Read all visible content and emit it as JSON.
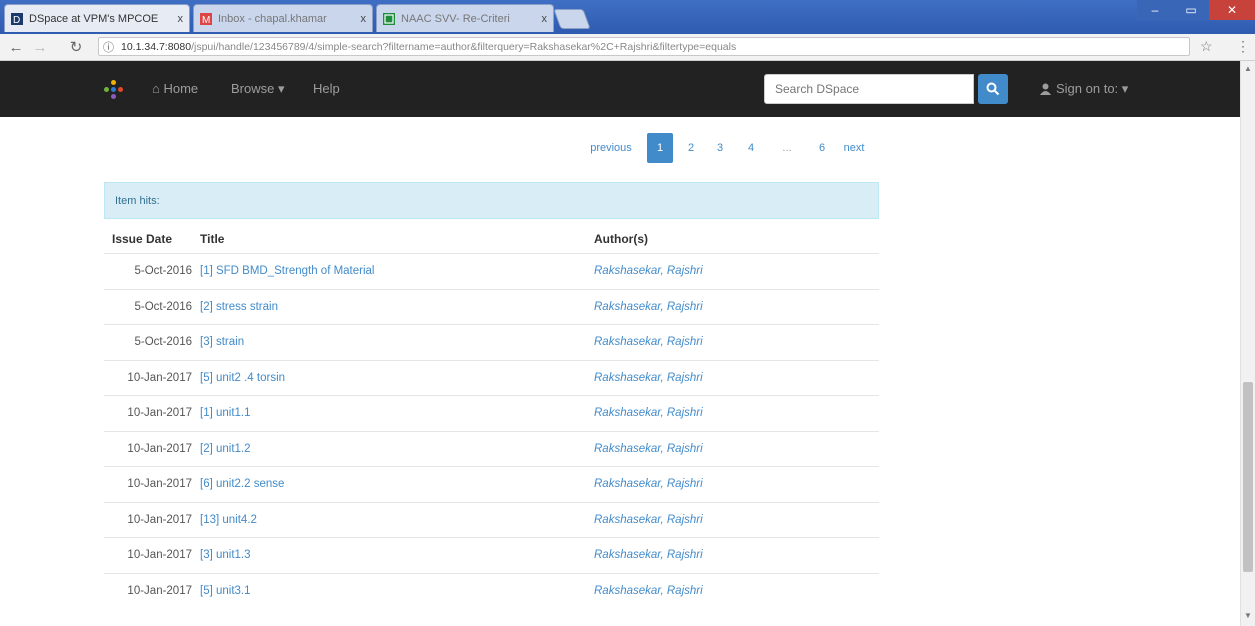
{
  "browser": {
    "tabs": [
      {
        "label": "DSpace at VPM's MPCOE",
        "active": true
      },
      {
        "label": "Inbox - chapal.khamar",
        "active": false
      },
      {
        "label": "NAAC SVV- Re-Criteri",
        "active": false
      }
    ],
    "close_glyph": "x",
    "url_main": "10.1.34.7:8080",
    "url_rest": "/jspui/handle/123456789/4/simple-search?filtername=author&filterquery=Rakshasekar%2C+Rajshri&filtertype=equals",
    "icons": {
      "back": "back-arrow-icon",
      "forward": "forward-arrow-icon",
      "reload": "reload-icon",
      "info": "info-icon",
      "star": "bookmark-star-icon",
      "menu": "menu-icon"
    }
  },
  "navbar": {
    "home": "Home",
    "browse": "Browse ▾",
    "help": "Help",
    "search_placeholder": "Search DSpace",
    "signin": "Sign on to: ▾",
    "colors": {
      "bg": "#222222",
      "accent": "#428bca"
    }
  },
  "pagination": {
    "previous": "previous",
    "pages": [
      "1",
      "2",
      "3",
      "4"
    ],
    "ellipsis": "...",
    "last_page": "6",
    "next": "next",
    "active": "1"
  },
  "results": {
    "header": "Item hits:",
    "columns": {
      "date": "Issue Date",
      "title": "Title",
      "author": "Author(s)"
    },
    "rows": [
      {
        "date": "5-Oct-2016",
        "title": "[1] SFD BMD_Strength of Material",
        "author": "Rakshasekar, Rajshri"
      },
      {
        "date": "5-Oct-2016",
        "title": "[2] stress strain",
        "author": "Rakshasekar, Rajshri"
      },
      {
        "date": "5-Oct-2016",
        "title": "[3] strain",
        "author": "Rakshasekar, Rajshri"
      },
      {
        "date": "10-Jan-2017",
        "title": "[5] unit2 .4 torsin",
        "author": "Rakshasekar, Rajshri"
      },
      {
        "date": "10-Jan-2017",
        "title": "[1] unit1.1",
        "author": "Rakshasekar, Rajshri"
      },
      {
        "date": "10-Jan-2017",
        "title": "[2] unit1.2",
        "author": "Rakshasekar, Rajshri"
      },
      {
        "date": "10-Jan-2017",
        "title": "[6] unit2.2 sense",
        "author": "Rakshasekar, Rajshri"
      },
      {
        "date": "10-Jan-2017",
        "title": "[13] unit4.2",
        "author": "Rakshasekar, Rajshri"
      },
      {
        "date": "10-Jan-2017",
        "title": "[3] unit1.3",
        "author": "Rakshasekar, Rajshri"
      },
      {
        "date": "10-Jan-2017",
        "title": "[5] unit3.1",
        "author": "Rakshasekar, Rajshri"
      }
    ]
  }
}
